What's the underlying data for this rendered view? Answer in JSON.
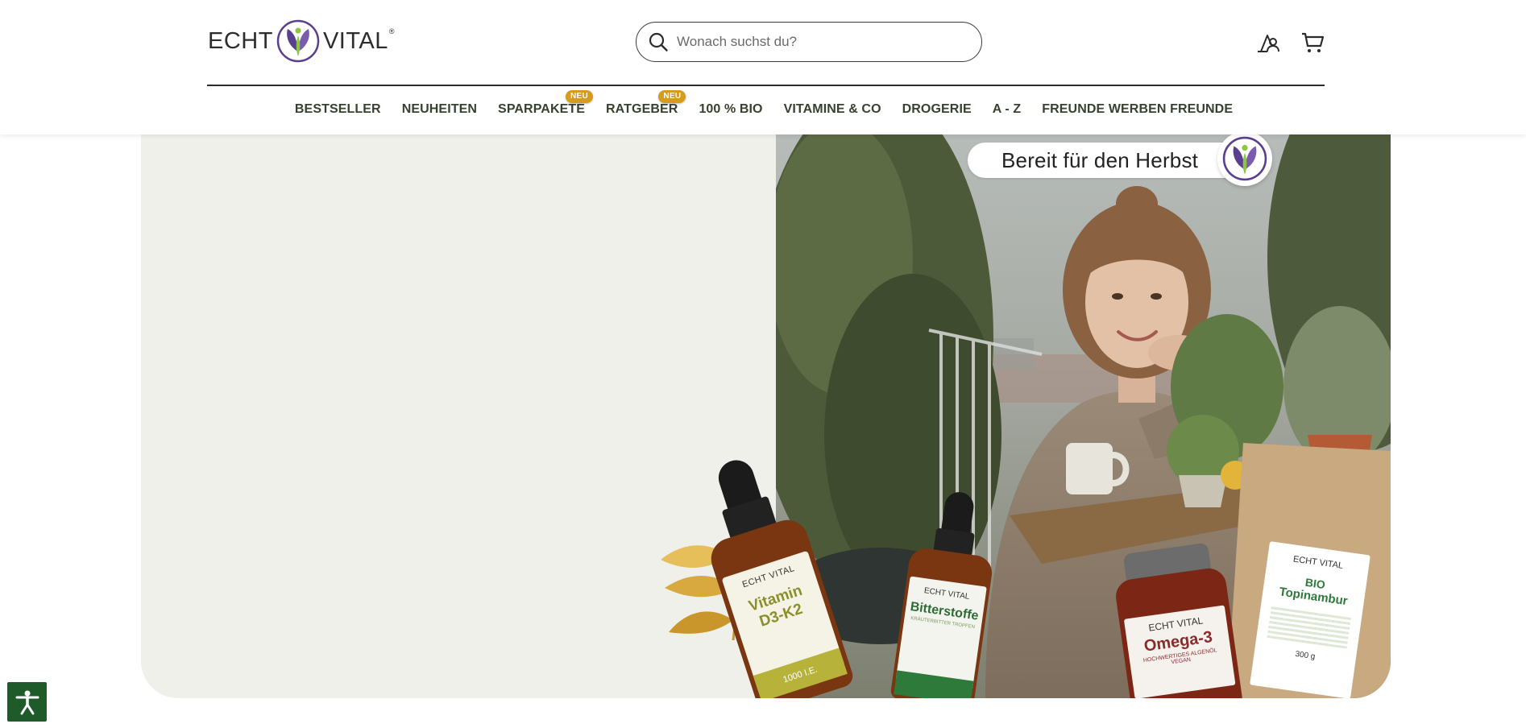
{
  "header": {
    "logo": {
      "left": "ECHT",
      "right": "VITAL",
      "reg": "®"
    },
    "search": {
      "placeholder": "Wonach suchst du?",
      "value": ""
    },
    "icons": {
      "account": "account-icon",
      "cart": "cart-icon",
      "search": "search-icon"
    }
  },
  "nav": {
    "items": [
      {
        "label": "BESTSELLER"
      },
      {
        "label": "NEUHEITEN"
      },
      {
        "label": "SPARPAKETE",
        "badge": "NEU"
      },
      {
        "label": "RATGEBER",
        "badge": "NEU"
      },
      {
        "label": "100 % BIO"
      },
      {
        "label": "VITAMINE & CO"
      },
      {
        "label": "DROGERIE"
      },
      {
        "label": "A - Z"
      },
      {
        "label": "FREUNDE WERBEN FREUNDE"
      }
    ]
  },
  "hero": {
    "campaign": "Bereit für den Herbst",
    "products": [
      {
        "brand": "ECHT VITAL",
        "name_line1": "Vitamin",
        "name_line2": "D3-K2",
        "detail": "1000 I.E."
      },
      {
        "brand": "ECHT VITAL",
        "name_line1": "Bitterstoffe",
        "detail": "KRÄUTERBITTER TROPFEN"
      },
      {
        "brand": "ECHT VITAL",
        "name_line1": "Omega-3",
        "detail": "HOCHWERTIGES ALGENÖL",
        "detail2": "VEGAN"
      },
      {
        "brand": "ECHT VITAL",
        "name_line1": "BIO",
        "name_line2": "Topinambur",
        "detail": "300 g"
      }
    ]
  },
  "accessibility": {
    "icon": "accessibility-icon"
  },
  "colors": {
    "nav_text": "#37412f",
    "badge": "#d59a1e",
    "hero_bg": "#f0f0eb",
    "brand_purple": "#5b3f8f",
    "brand_green": "#8dc63f",
    "a11y_bg": "#1f5a2b"
  }
}
